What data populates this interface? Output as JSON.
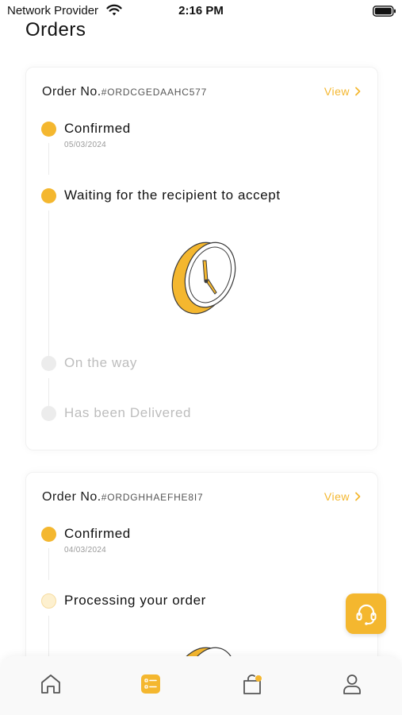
{
  "status_bar": {
    "carrier": "Network Provider",
    "time": "2:16 PM"
  },
  "page": {
    "title": "Orders"
  },
  "orders": [
    {
      "label": "Order No.",
      "id": "#ORDCGEDAAHC577",
      "view_label": "View",
      "steps": [
        {
          "title": "Confirmed",
          "date": "05/03/2024",
          "state": "done"
        },
        {
          "title": "Waiting for the recipient to accept",
          "state": "current"
        },
        {
          "title": "On the way",
          "state": "inactive"
        },
        {
          "title": "Has been Delivered",
          "state": "inactive"
        }
      ]
    },
    {
      "label": "Order No.",
      "id": "#ORDGHHAEFHE8I7",
      "view_label": "View",
      "steps": [
        {
          "title": "Confirmed",
          "date": "04/03/2024",
          "state": "done"
        },
        {
          "title": "Processing your order",
          "state": "pending"
        }
      ]
    }
  ],
  "tab_bar": {
    "tabs": [
      "home-icon",
      "orders-icon",
      "cart-icon",
      "profile-icon"
    ],
    "active_tab": "orders-icon"
  },
  "colors": {
    "accent": "#f4b72f",
    "inactive": "#ececec",
    "inactive_text": "#bdbdbd"
  },
  "icons": {
    "support_button": "headset-icon"
  }
}
